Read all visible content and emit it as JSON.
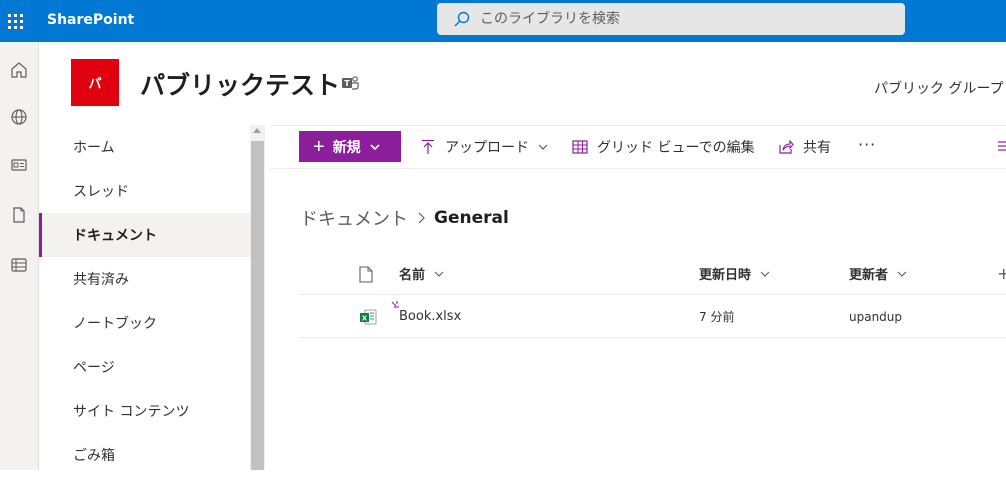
{
  "suitebar": {
    "app_name": "SharePoint",
    "search_placeholder": "このライブラリを検索",
    "accent": "#0078d4"
  },
  "app_rail": {
    "items": [
      {
        "name": "home-icon"
      },
      {
        "name": "globe-icon"
      },
      {
        "name": "news-icon"
      },
      {
        "name": "document-icon"
      },
      {
        "name": "list-icon"
      }
    ]
  },
  "site_header": {
    "logo_letter": "パ",
    "logo_color": "#e0000f",
    "title": "パブリックテスト",
    "group_label": "パブリック グループ"
  },
  "left_nav": {
    "items": [
      {
        "label": "ホーム",
        "active": false
      },
      {
        "label": "スレッド",
        "active": false
      },
      {
        "label": "ドキュメント",
        "active": true
      },
      {
        "label": "共有済み",
        "active": false
      },
      {
        "label": "ノートブック",
        "active": false
      },
      {
        "label": "ページ",
        "active": false
      },
      {
        "label": "サイト コンテンツ",
        "active": false
      },
      {
        "label": "ごみ箱",
        "active": false
      }
    ]
  },
  "command_bar": {
    "new_label": "新規",
    "upload_label": "アップロード",
    "grid_edit_label": "グリッド ビューでの編集",
    "share_label": "共有",
    "more_label": "···",
    "brand_color": "#8b1e9b"
  },
  "breadcrumb": {
    "root": "ドキュメント",
    "current": "General"
  },
  "file_list": {
    "columns": {
      "name": "名前",
      "modified": "更新日時",
      "modified_by": "更新者",
      "add_column": "+"
    },
    "rows": [
      {
        "name": "Book.xlsx",
        "modified": "7 分前",
        "modified_by": "upandup"
      }
    ]
  }
}
